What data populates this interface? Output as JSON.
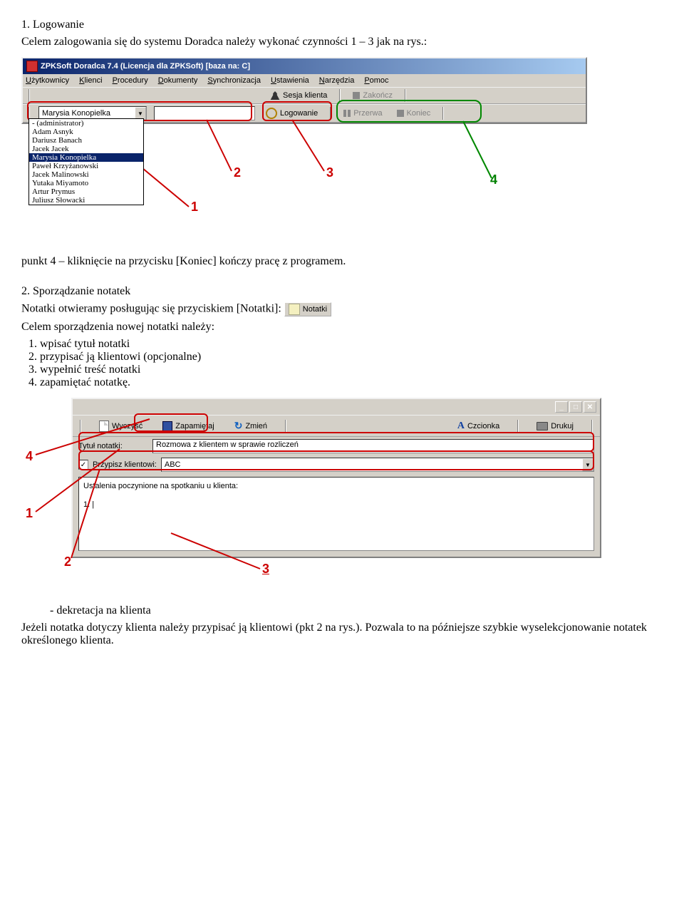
{
  "section1": {
    "heading": "1. Logowanie",
    "intro": "Celem zalogowania się do systemu Doradca należy wykonać czynności 1 – 3 jak na rys.:",
    "caption_below": "punkt 4 – kliknięcie na przycisku [Koniec] kończy pracę z programem."
  },
  "app_window": {
    "title": "ZPKSoft Doradca 7.4 (Licencja dla ZPKSoft) [baza na: C]",
    "menu": [
      "Użytkownicy",
      "Klienci",
      "Procedury",
      "Dokumenty",
      "Synchronizacja",
      "Ustawienia",
      "Narzędzia",
      "Pomoc"
    ],
    "toolbar_upper": {
      "sesja": "Sesja klienta",
      "zakoncz": "Zakończ"
    },
    "toolbar_lower": {
      "selected_user": "Marysia Konopielka",
      "logowanie": "Logowanie",
      "przerwa": "Przerwa",
      "koniec": "Koniec"
    },
    "dropdown": [
      "- (administrator)",
      "Adam Asnyk",
      "Dariusz Banach",
      "Jacek Jacek",
      "Marysia Konopielka",
      "Paweł Krzyżanowski",
      "Jacek Malinowski",
      "Yutaka Miyamoto",
      "Artur Prymus",
      "Juliusz Słowacki"
    ],
    "dropdown_selected_index": 4
  },
  "annotations1": {
    "a1": "1",
    "a2": "2",
    "a3": "3",
    "a4": "4"
  },
  "section2": {
    "heading": "2. Sporządzanie notatek",
    "line1_a": "Notatki otwieramy posługując się przyciskiem [Notatki]: ",
    "notatki_label": "Notatki",
    "line2": "Celem sporządzenia nowej notatki należy:",
    "steps": [
      "wpisać tytuł notatki",
      "przypisać ją klientowi (opcjonalne)",
      "wypełnić treść notatki",
      "zapamiętać notatkę."
    ]
  },
  "notes_window": {
    "buttons": {
      "wyczysc": "Wyczyść",
      "zapamietaj": "Zapamiętaj",
      "zmien": "Zmień",
      "czcionka": "Czcionka",
      "drukuj": "Drukuj"
    },
    "row_tytul_label": "Tytuł notatki:",
    "row_tytul_value": "Rozmowa z klientem w sprawie rozliczeń",
    "row_przypisz_label": "Przypisz klientowi:",
    "row_przypisz_value": "ABC",
    "body_line1": "Ustalenia poczynione na spotkaniu u klienta:",
    "body_line2": "1. |"
  },
  "annotations2": {
    "a1": "1",
    "a2": "2",
    "a3": "3",
    "a4": "4"
  },
  "section3": {
    "heading": "- dekretacja na klienta",
    "para": "Jeżeli notatka dotyczy klienta należy przypisać ją klientowi (pkt 2 na rys.). Pozwala to na późniejsze szybkie wyselekcjonowanie notatek określonego klienta."
  }
}
